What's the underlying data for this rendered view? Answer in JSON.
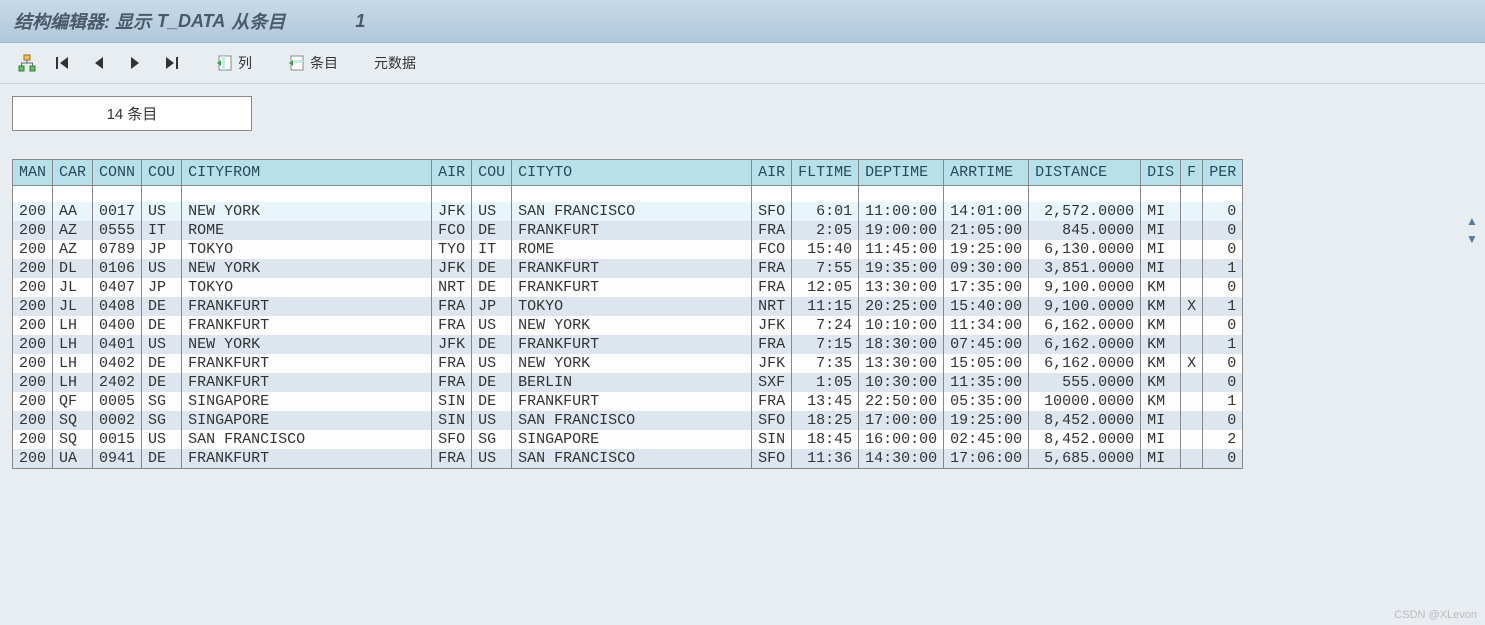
{
  "title": {
    "prefix": "结构编辑器: 显示",
    "tname": "T_DATA",
    "suffix": "从条目",
    "index": "1"
  },
  "toolbar": {
    "column_label": "列",
    "entry_label": "条目",
    "meta_label": "元数据"
  },
  "count_text": "14 条目",
  "columns": [
    "MAN",
    "CAR",
    "CONN",
    "COU",
    "CITYFROM",
    "AIR",
    "COU",
    "CITYTO",
    "AIR",
    "FLTIME",
    "DEPTIME",
    "ARRTIME",
    "DISTANCE",
    "DIS",
    "F",
    "PER"
  ],
  "col_widths": [
    "34",
    "34",
    "42",
    "34",
    "250",
    "34",
    "34",
    "240",
    "34",
    "60",
    "80",
    "80",
    "112",
    "30",
    "16",
    "36"
  ],
  "num_cols": [
    9,
    12,
    15
  ],
  "rows": [
    [
      "200",
      "AA",
      "0017",
      "US",
      "NEW YORK",
      "JFK",
      "US",
      "SAN FRANCISCO",
      "SFO",
      "6:01",
      "11:00:00",
      "14:01:00",
      "2,572.0000",
      "MI",
      "",
      "0"
    ],
    [
      "200",
      "AZ",
      "0555",
      "IT",
      "ROME",
      "FCO",
      "DE",
      "FRANKFURT",
      "FRA",
      "2:05",
      "19:00:00",
      "21:05:00",
      "845.0000",
      "MI",
      "",
      "0"
    ],
    [
      "200",
      "AZ",
      "0789",
      "JP",
      "TOKYO",
      "TYO",
      "IT",
      "ROME",
      "FCO",
      "15:40",
      "11:45:00",
      "19:25:00",
      "6,130.0000",
      "MI",
      "",
      "0"
    ],
    [
      "200",
      "DL",
      "0106",
      "US",
      "NEW YORK",
      "JFK",
      "DE",
      "FRANKFURT",
      "FRA",
      "7:55",
      "19:35:00",
      "09:30:00",
      "3,851.0000",
      "MI",
      "",
      "1"
    ],
    [
      "200",
      "JL",
      "0407",
      "JP",
      "TOKYO",
      "NRT",
      "DE",
      "FRANKFURT",
      "FRA",
      "12:05",
      "13:30:00",
      "17:35:00",
      "9,100.0000",
      "KM",
      "",
      "0"
    ],
    [
      "200",
      "JL",
      "0408",
      "DE",
      "FRANKFURT",
      "FRA",
      "JP",
      "TOKYO",
      "NRT",
      "11:15",
      "20:25:00",
      "15:40:00",
      "9,100.0000",
      "KM",
      "X",
      "1"
    ],
    [
      "200",
      "LH",
      "0400",
      "DE",
      "FRANKFURT",
      "FRA",
      "US",
      "NEW YORK",
      "JFK",
      "7:24",
      "10:10:00",
      "11:34:00",
      "6,162.0000",
      "KM",
      "",
      "0"
    ],
    [
      "200",
      "LH",
      "0401",
      "US",
      "NEW YORK",
      "JFK",
      "DE",
      "FRANKFURT",
      "FRA",
      "7:15",
      "18:30:00",
      "07:45:00",
      "6,162.0000",
      "KM",
      "",
      "1"
    ],
    [
      "200",
      "LH",
      "0402",
      "DE",
      "FRANKFURT",
      "FRA",
      "US",
      "NEW YORK",
      "JFK",
      "7:35",
      "13:30:00",
      "15:05:00",
      "6,162.0000",
      "KM",
      "X",
      "0"
    ],
    [
      "200",
      "LH",
      "2402",
      "DE",
      "FRANKFURT",
      "FRA",
      "DE",
      "BERLIN",
      "SXF",
      "1:05",
      "10:30:00",
      "11:35:00",
      "555.0000",
      "KM",
      "",
      "0"
    ],
    [
      "200",
      "QF",
      "0005",
      "SG",
      "SINGAPORE",
      "SIN",
      "DE",
      "FRANKFURT",
      "FRA",
      "13:45",
      "22:50:00",
      "05:35:00",
      "10000.0000",
      "KM",
      "",
      "1"
    ],
    [
      "200",
      "SQ",
      "0002",
      "SG",
      "SINGAPORE",
      "SIN",
      "US",
      "SAN FRANCISCO",
      "SFO",
      "18:25",
      "17:00:00",
      "19:25:00",
      "8,452.0000",
      "MI",
      "",
      "0"
    ],
    [
      "200",
      "SQ",
      "0015",
      "US",
      "SAN FRANCISCO",
      "SFO",
      "SG",
      "SINGAPORE",
      "SIN",
      "18:45",
      "16:00:00",
      "02:45:00",
      "8,452.0000",
      "MI",
      "",
      "2"
    ],
    [
      "200",
      "UA",
      "0941",
      "DE",
      "FRANKFURT",
      "FRA",
      "US",
      "SAN FRANCISCO",
      "SFO",
      "11:36",
      "14:30:00",
      "17:06:00",
      "5,685.0000",
      "MI",
      "",
      "0"
    ]
  ],
  "watermark": "CSDN @XLevon"
}
